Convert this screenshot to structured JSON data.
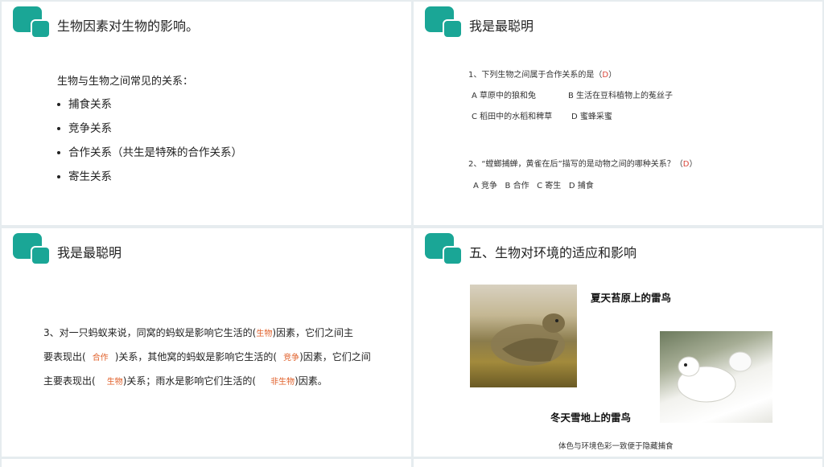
{
  "colors": {
    "accent": "#1aa696",
    "answer": "#d9463b",
    "fill": "#e0602a"
  },
  "slide1": {
    "title": "生物因素对生物的影响。",
    "intro": "生物与生物之间常见的关系：",
    "bullets": [
      "捕食关系",
      "竞争关系",
      "合作关系（共生是特殊的合作关系）",
      "寄生关系"
    ]
  },
  "slide2": {
    "title": "我是最聪明",
    "q1": {
      "text": "1、下列生物之间属于合作关系的是（",
      "answer": "D",
      "close": "）",
      "options": [
        "A 草原中的狼和兔",
        "B 生活在豆科植物上的菟丝子",
        "C 稻田中的水稻和稗草",
        "D 蜜蜂采蜜"
      ]
    },
    "q2": {
      "text": "2、“螳螂捕蝉，黄雀在后”描写的是动物之间的哪种关系？（",
      "answer": "D",
      "close": "）",
      "options": "A 竞争   B 合作   C 寄生   D 捕食"
    }
  },
  "slide3": {
    "title": "我是最聪明",
    "line1_a": "3、对一只蚂蚁来说，同窝的蚂蚁是影响它生活的(",
    "fill1": "生物",
    "line1_b": ")因素，它们之间主",
    "line2_a": "要表现出(",
    "fill2": "合作",
    "line2_b": ")关系，其他窝的蚂蚁是影响它生活的(",
    "fill3": "竞争",
    "line2_c": ")因素，它们之间",
    "line3_a": "主要表现出(",
    "fill4": "生物",
    "line3_b": ")关系；雨水是影响它们生活的(",
    "fill5": "非生物",
    "line3_c": ")因素。"
  },
  "slide4": {
    "title": "五、生物对环境的适应和影响",
    "caption_summer": "夏天苔原上的雷鸟",
    "caption_winter": "冬天雪地上的雷鸟",
    "note": "体色与环境色彩一致便于隐藏捕食"
  }
}
